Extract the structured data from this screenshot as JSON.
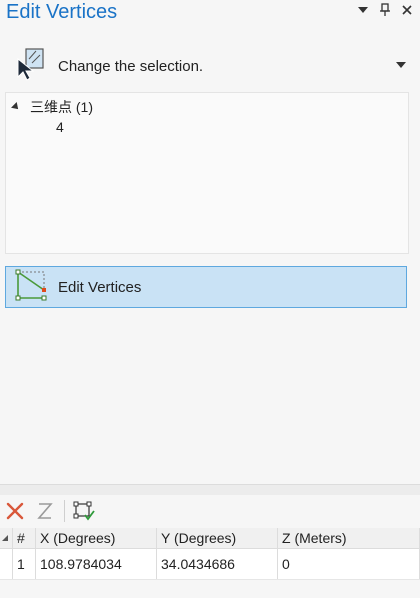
{
  "pane": {
    "title": "Edit Vertices",
    "controls": [
      "menu-icon",
      "pin-icon",
      "close-icon"
    ]
  },
  "selection": {
    "label": "Change the selection."
  },
  "tree": {
    "node_label": "三维点 (1)",
    "child_label": "4"
  },
  "edit_button": {
    "label": "Edit Vertices"
  },
  "toolbar": {
    "tools": [
      "delete-icon",
      "z-icon",
      "vertex-check-icon"
    ]
  },
  "table": {
    "headers": [
      "#",
      "X (Degrees)",
      "Y (Degrees)",
      "Z (Meters)"
    ],
    "rows": [
      [
        "1",
        "108.9784034",
        "34.0434686",
        "0"
      ]
    ]
  }
}
